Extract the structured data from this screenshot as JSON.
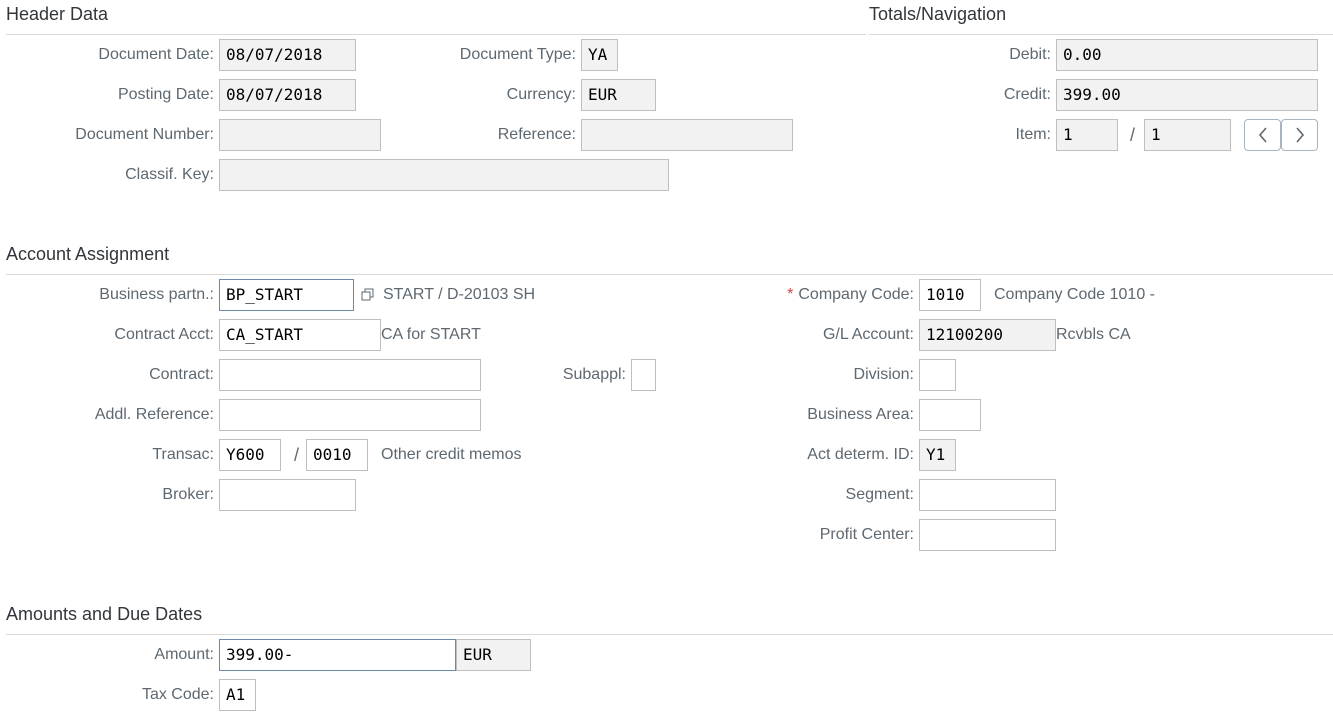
{
  "header": {
    "title": "Header Data",
    "document_date": {
      "label": "Document Date:",
      "value": "08/07/2018"
    },
    "posting_date": {
      "label": "Posting Date:",
      "value": "08/07/2018"
    },
    "document_number": {
      "label": "Document Number:",
      "value": ""
    },
    "classif_key": {
      "label": "Classif. Key:",
      "value": ""
    },
    "document_type": {
      "label": "Document Type:",
      "value": "YA"
    },
    "currency": {
      "label": "Currency:",
      "value": "EUR"
    },
    "reference": {
      "label": "Reference:",
      "value": ""
    }
  },
  "totals": {
    "title": "Totals/Navigation",
    "debit": {
      "label": "Debit:",
      "value": "0.00"
    },
    "credit": {
      "label": "Credit:",
      "value": "399.00"
    },
    "item": {
      "label": "Item:",
      "value": "1",
      "separator": "/",
      "total": "1"
    },
    "prev_icon": "chevron-left-icon",
    "next_icon": "chevron-right-icon"
  },
  "account": {
    "title": "Account Assignment",
    "business_partner": {
      "label": "Business partn.:",
      "value": "BP_START",
      "description": "START / D-20103 SH",
      "help_icon": "value-help-icon"
    },
    "contract_acct": {
      "label": "Contract Acct:",
      "value": "CA_START",
      "description": "CA for START"
    },
    "contract": {
      "label": "Contract:",
      "value": ""
    },
    "subappl": {
      "label": "Subappl:",
      "value": ""
    },
    "addl_reference": {
      "label": "Addl. Reference:",
      "value": ""
    },
    "transac": {
      "label": "Transac:",
      "main": "Y600",
      "separator": "/",
      "sub": "0010",
      "description": "Other credit memos"
    },
    "broker": {
      "label": "Broker:",
      "value": ""
    },
    "company_code": {
      "label": "Company Code:",
      "required_marker": "*",
      "value": "1010",
      "description": "Company Code 1010 -"
    },
    "gl_account": {
      "label": "G/L Account:",
      "value": "12100200",
      "description": "Rcvbls CA"
    },
    "division": {
      "label": "Division:",
      "value": ""
    },
    "business_area": {
      "label": "Business Area:",
      "value": ""
    },
    "act_determ_id": {
      "label": "Act determ. ID:",
      "value": "Y1"
    },
    "segment": {
      "label": "Segment:",
      "value": ""
    },
    "profit_center": {
      "label": "Profit Center:",
      "value": ""
    }
  },
  "amounts": {
    "title": "Amounts and Due Dates",
    "amount": {
      "label": "Amount:",
      "value": "399.00-",
      "currency": "EUR"
    },
    "tax_code": {
      "label": "Tax Code:",
      "value": "A1"
    }
  },
  "colors": {
    "required": "#d04343",
    "label": "#5e6870",
    "readonly_bg": "#f2f2f2",
    "border": "#bfbfbf"
  }
}
